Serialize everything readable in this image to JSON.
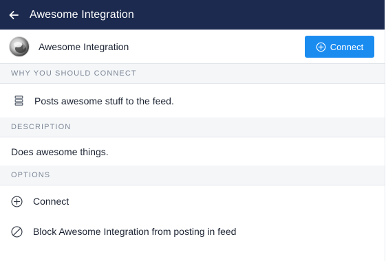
{
  "header": {
    "title": "Awesome Integration",
    "back_icon": "arrow-left-icon"
  },
  "app": {
    "name": "Awesome Integration",
    "connect_label": "Connect"
  },
  "sections": {
    "why_title": "WHY YOU SHOULD CONNECT",
    "why_items": [
      "Posts awesome stuff to the feed."
    ],
    "description_title": "DESCRIPTION",
    "description_text": "Does awesome things.",
    "options_title": "OPTIONS",
    "options": [
      {
        "label": "Connect",
        "icon": "plus-circle-icon"
      },
      {
        "label": "Block Awesome Integration from posting in feed",
        "icon": "block-icon"
      }
    ]
  },
  "colors": {
    "header_bg": "#1b2a4e",
    "accent": "#1a8cf0",
    "section_bg": "#f4f6f8"
  }
}
